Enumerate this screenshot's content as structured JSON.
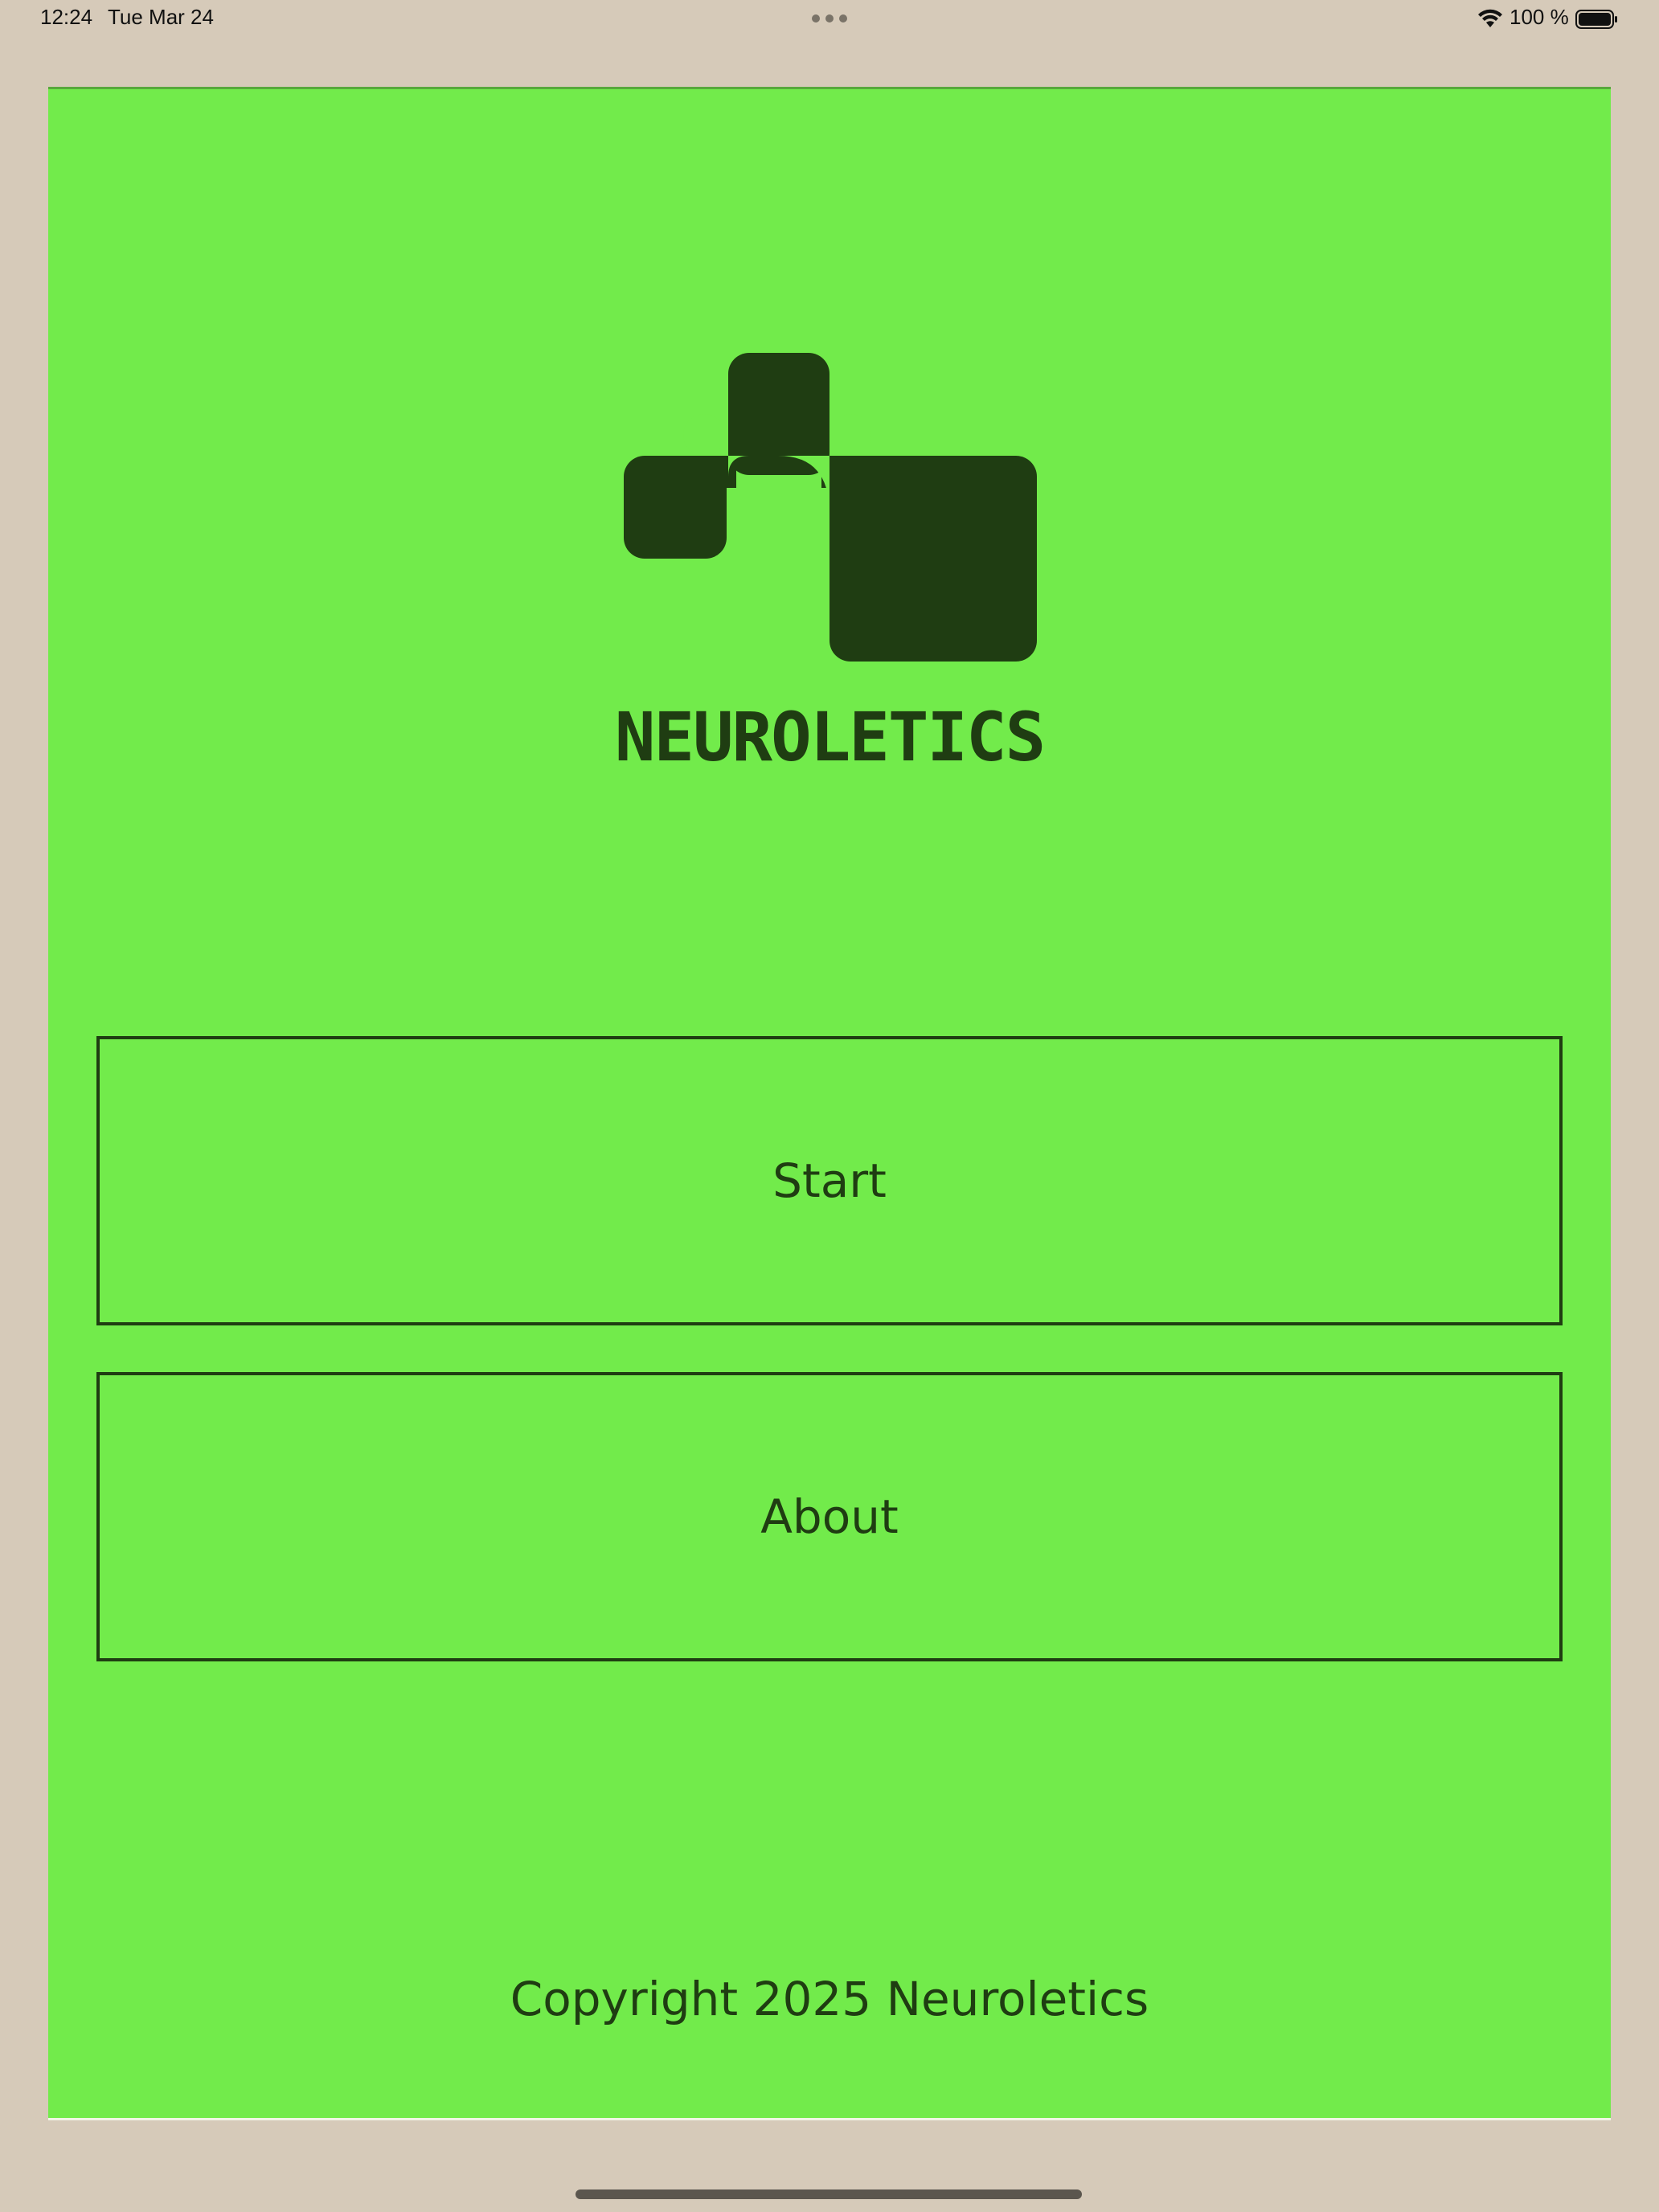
{
  "status_bar": {
    "time": "12:24",
    "date": "Tue Mar 24",
    "battery_percent": "100 %",
    "wifi_icon": "wifi-icon",
    "battery_icon": "battery-full-icon"
  },
  "app": {
    "logo_icon": "neuroletics-logo",
    "wordmark": "NEUROLETICS",
    "buttons": {
      "start_label": "Start",
      "about_label": "About"
    },
    "copyright": "Copyright 2025 Neuroletics"
  },
  "colors": {
    "background": "#72eb4b",
    "foreground": "#1f3d12",
    "frame": "#d6cab9"
  }
}
